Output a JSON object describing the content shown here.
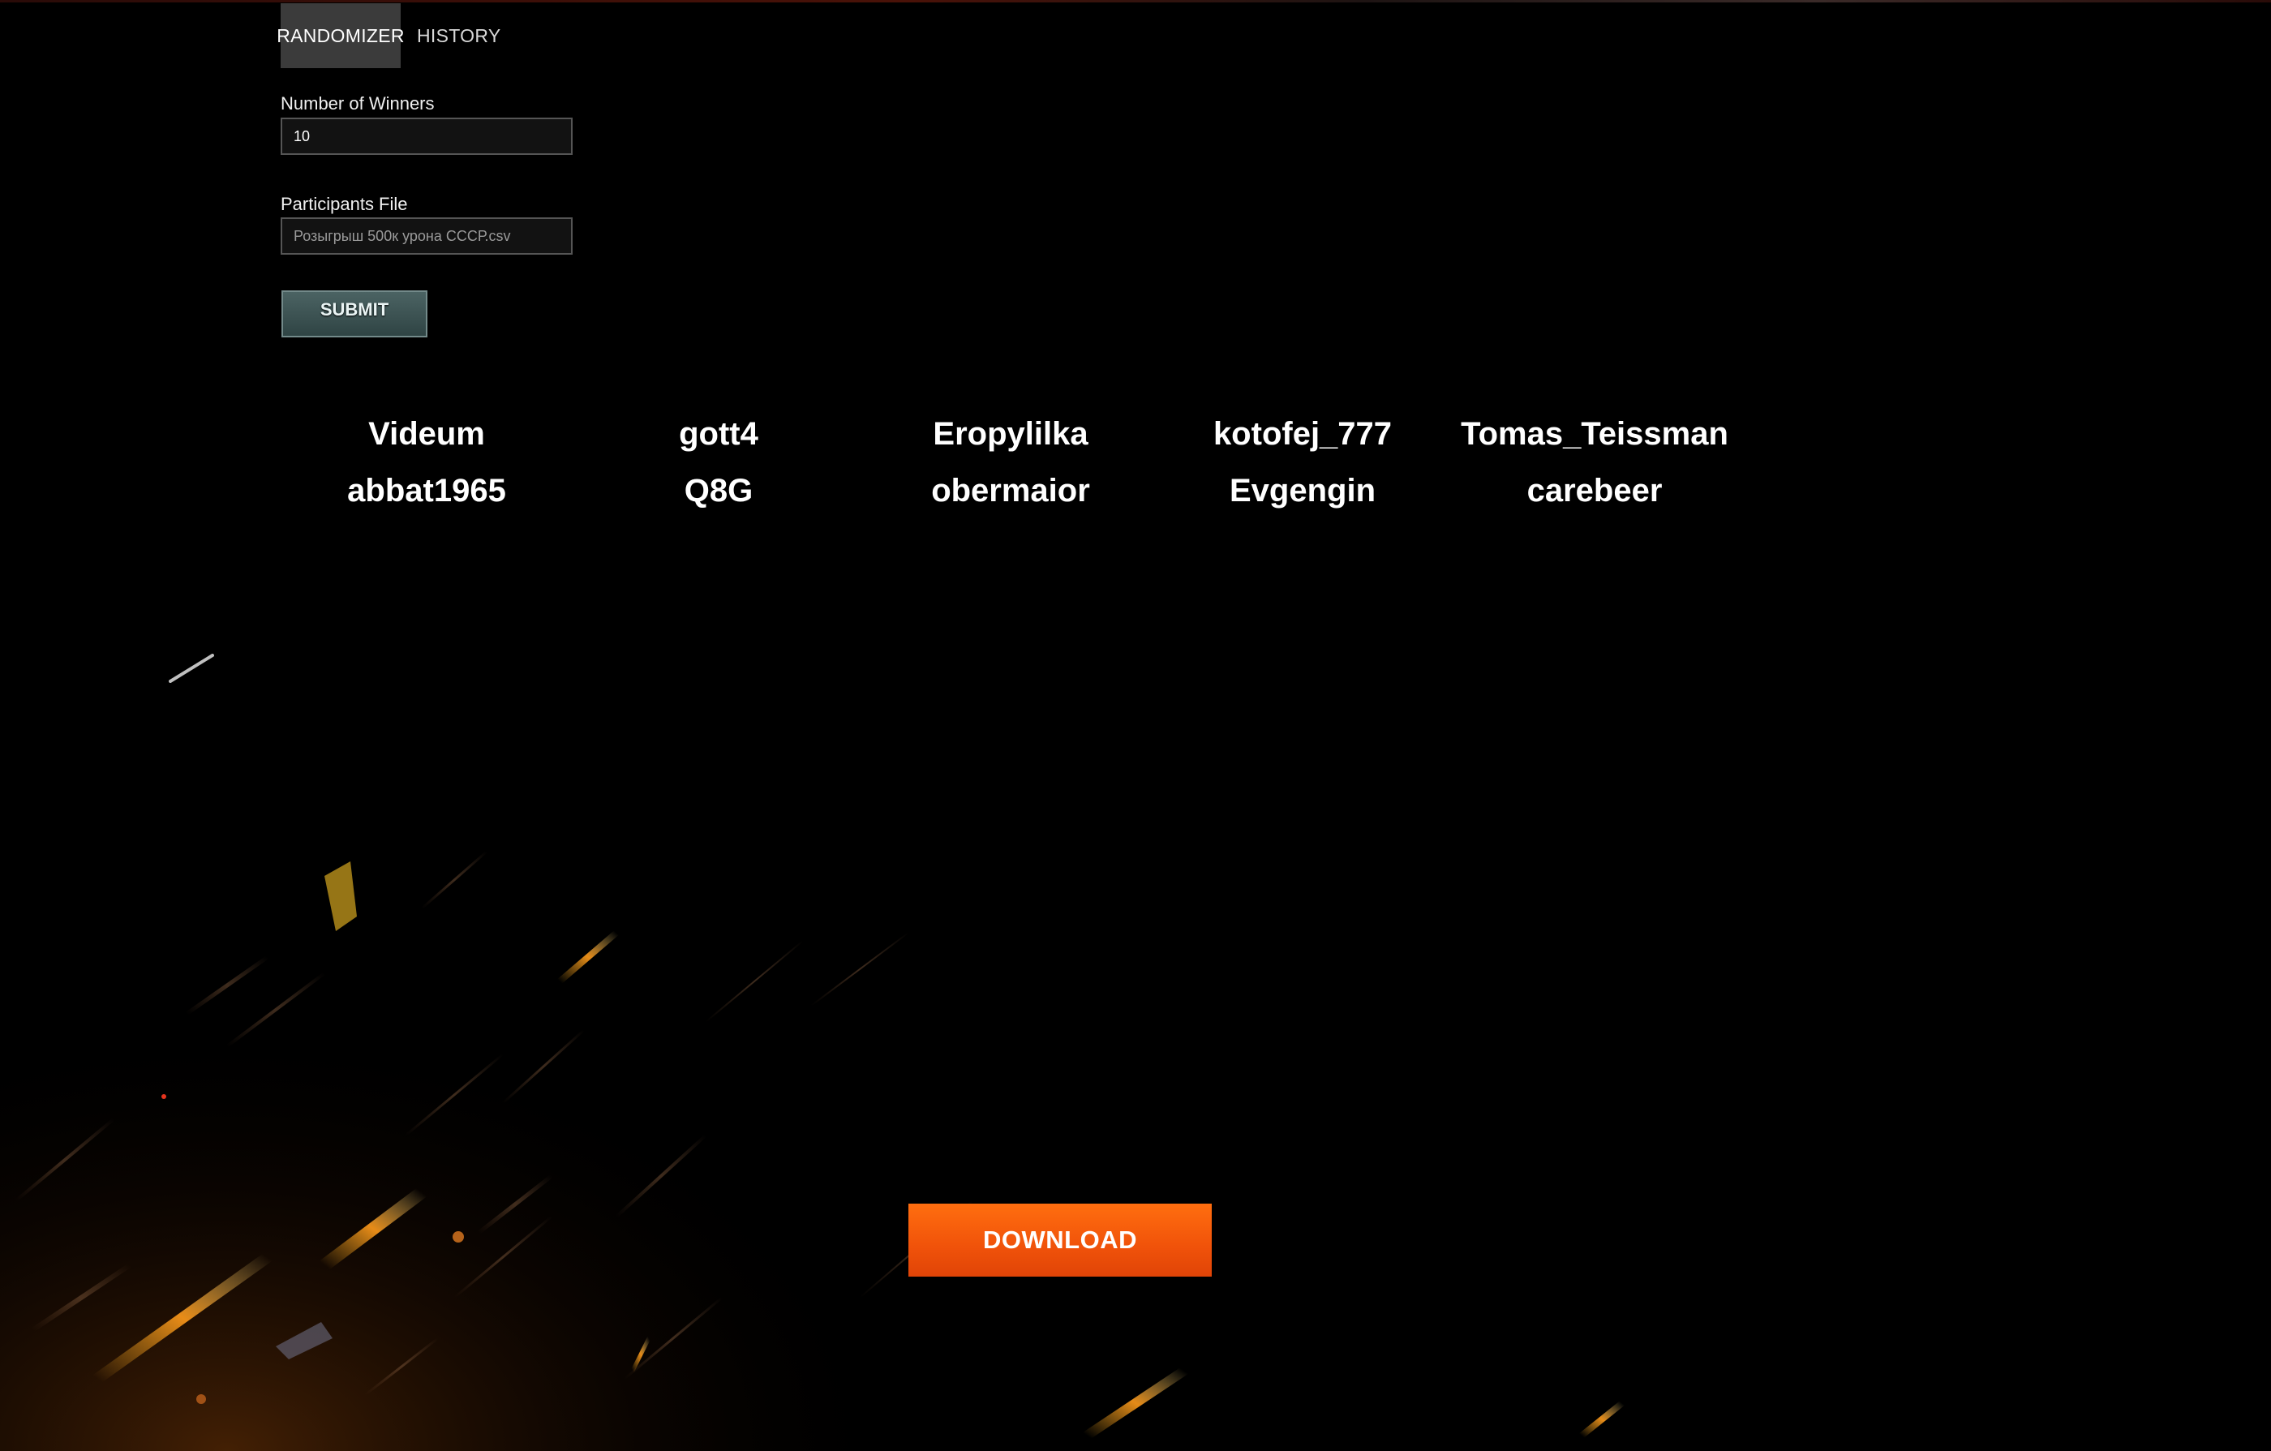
{
  "tabs": {
    "randomizer_label": "RANDOMIZER",
    "history_label": "HISTORY"
  },
  "form": {
    "winners_label": "Number of Winners",
    "winners_value": "10",
    "file_label": "Participants File",
    "file_value": "Розыгрыш 500к урона СССР.csv",
    "submit_label": "SUBMIT"
  },
  "winners": [
    "Videum",
    "gott4",
    "Eropylilka",
    "kotofej_777",
    "Tomas_Teissman",
    "abbat1965",
    "Q8G",
    "obermaior",
    "Evgengin",
    "carebeer"
  ],
  "download_label": "DOWNLOAD",
  "colors": {
    "background": "#000000",
    "active_tab": "#3b3b3b",
    "submit": "#3c5252",
    "download": "#f0520a"
  }
}
